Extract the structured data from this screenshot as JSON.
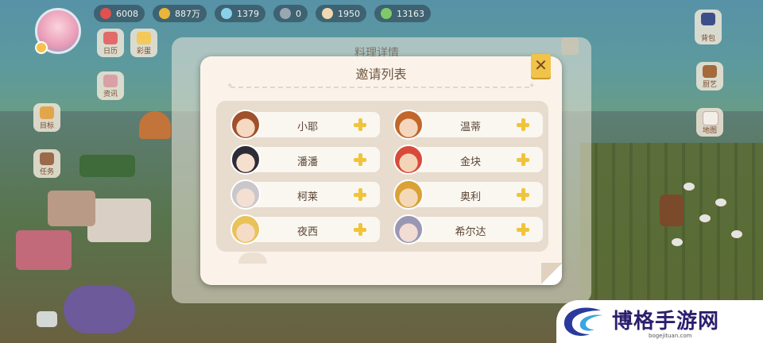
{
  "resources": [
    {
      "icon": "heart-icon",
      "color": "#e2504f",
      "value": "6008"
    },
    {
      "icon": "coin-icon",
      "color": "#e9b53a",
      "value": "887万"
    },
    {
      "icon": "crystal-icon",
      "color": "#8ad0ea",
      "value": "1379"
    },
    {
      "icon": "token-icon",
      "color": "#9aa6b0",
      "value": "0"
    },
    {
      "icon": "hamster-icon",
      "color": "#f0d8b0",
      "value": "1950"
    },
    {
      "icon": "exp-icon",
      "color": "#7fc96a",
      "value": "13163"
    }
  ],
  "side_buttons_left": [
    "日历",
    "彩蛋",
    "资讯",
    "目标",
    "任务"
  ],
  "side_buttons_right": [
    "背包",
    "厨艺",
    "地图"
  ],
  "back_panel": {
    "title": "料理详情"
  },
  "modal": {
    "title": "邀请列表"
  },
  "friends": [
    {
      "name": "小耶",
      "hair": "#a0502a",
      "skin": "#f5d9c2"
    },
    {
      "name": "温蒂",
      "hair": "#c2662a",
      "skin": "#f4d7be"
    },
    {
      "name": "潘潘",
      "hair": "#2d2c36",
      "skin": "#f5e0d0"
    },
    {
      "name": "金块",
      "hair": "#d84a3a",
      "skin": "#f3d4b6"
    },
    {
      "name": "柯莱",
      "hair": "#c9c6cc",
      "skin": "#f4dfd2"
    },
    {
      "name": "奥利",
      "hair": "#d9a236",
      "skin": "#f4d8b8"
    },
    {
      "name": "夜西",
      "hair": "#e9c25a",
      "skin": "#f6dcc6"
    },
    {
      "name": "希尔达",
      "hair": "#9a97b4",
      "skin": "#f2dcd3"
    }
  ],
  "watermark": {
    "brand": "博格手游网",
    "url": "bogejituan.com"
  }
}
